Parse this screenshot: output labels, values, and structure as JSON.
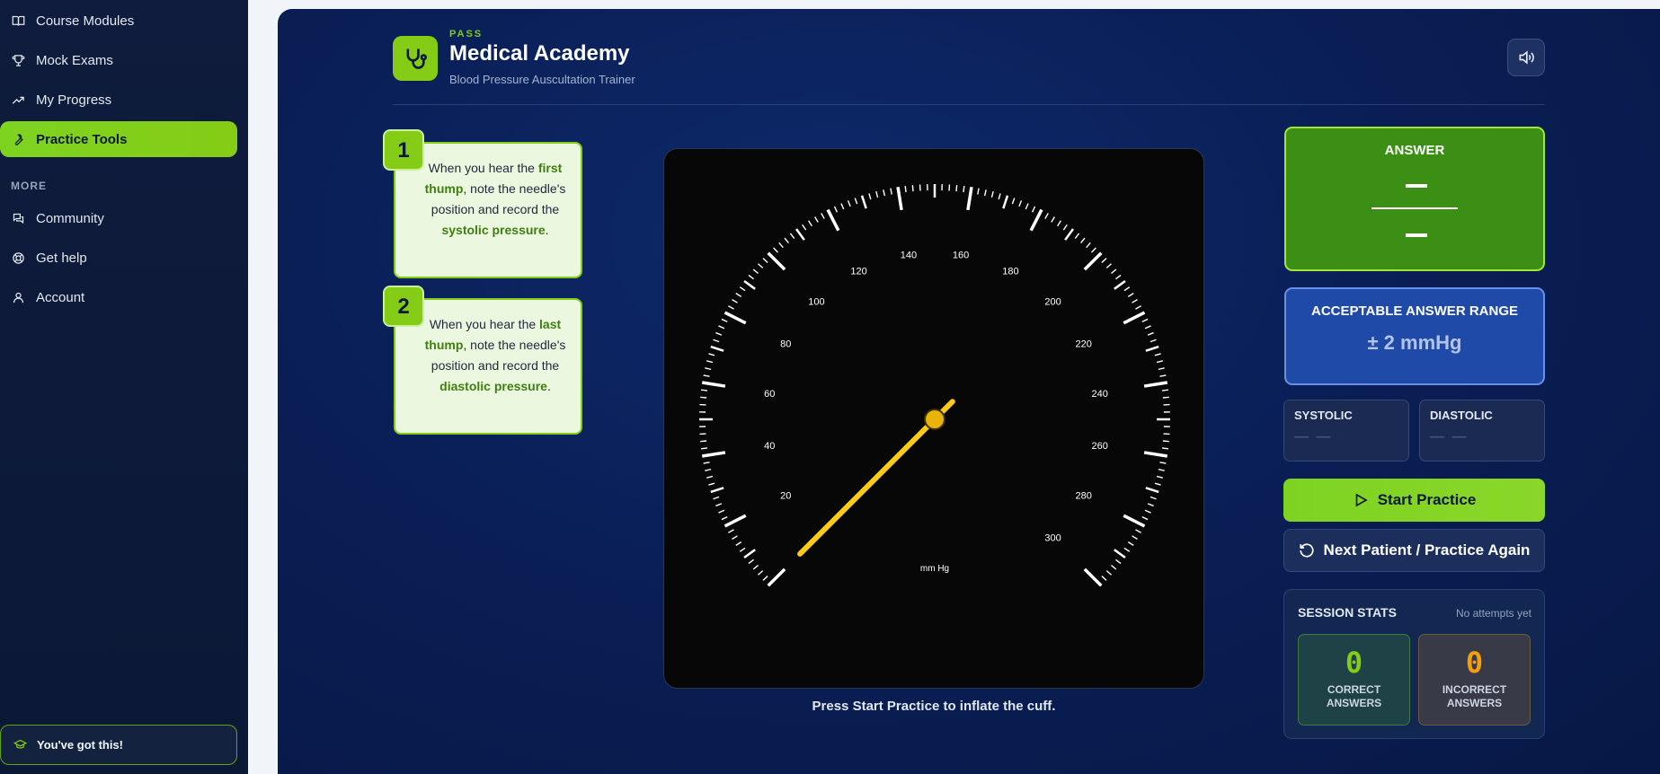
{
  "sidebar": {
    "items": [
      {
        "label": "Course Modules",
        "icon": "book-icon"
      },
      {
        "label": "Mock Exams",
        "icon": "trophy-icon"
      },
      {
        "label": "My Progress",
        "icon": "trending-up-icon"
      },
      {
        "label": "Practice Tools",
        "icon": "wrench-icon",
        "active": true
      }
    ],
    "section_label": "MORE",
    "more_items": [
      {
        "label": "Community",
        "icon": "chat-icon"
      },
      {
        "label": "Get help",
        "icon": "lifebuoy-icon"
      },
      {
        "label": "Account",
        "icon": "user-icon"
      }
    ],
    "encouragement": "You've got this!"
  },
  "header": {
    "badge": "PASS",
    "title": "Medical Academy",
    "subtitle": "Blood Pressure Auscultation Trainer"
  },
  "steps": [
    {
      "number": "1",
      "pre": "When you hear the ",
      "hl1": "first thump",
      "mid": ", note the needle's position and record the ",
      "hl2": "systolic pressure",
      "post": "."
    },
    {
      "number": "2",
      "pre": "When you hear the ",
      "hl1": "last thump",
      "mid": ", note the needle's position and record the ",
      "hl2": "diastolic pressure",
      "post": "."
    }
  ],
  "gauge": {
    "unit": "mm Hg",
    "min": 0,
    "max": 300,
    "labels": [
      20,
      40,
      60,
      80,
      100,
      120,
      140,
      160,
      180,
      200,
      220,
      240,
      260,
      280,
      300
    ],
    "needle_value": 0,
    "hint": "Press Start Practice to inflate the cuff."
  },
  "answer": {
    "title": "ANSWER"
  },
  "range": {
    "title": "ACCEPTABLE ANSWER RANGE",
    "value": "± 2 mmHg"
  },
  "systolic": {
    "label": "SYSTOLIC",
    "value": "— —"
  },
  "diastolic": {
    "label": "DIASTOLIC",
    "value": "— —"
  },
  "buttons": {
    "start": "Start Practice",
    "next": "Next Patient / Practice Again"
  },
  "stats": {
    "title": "SESSION STATS",
    "note": "No attempts yet",
    "correct": {
      "value": "0",
      "label": "CORRECT ANSWERS"
    },
    "incorrect": {
      "value": "0",
      "label": "INCORRECT ANSWERS"
    }
  },
  "colors": {
    "accent": "#84cc16",
    "panel": "#0a1f57",
    "sidebar": "#0f1c3d",
    "needle": "#facc15"
  }
}
